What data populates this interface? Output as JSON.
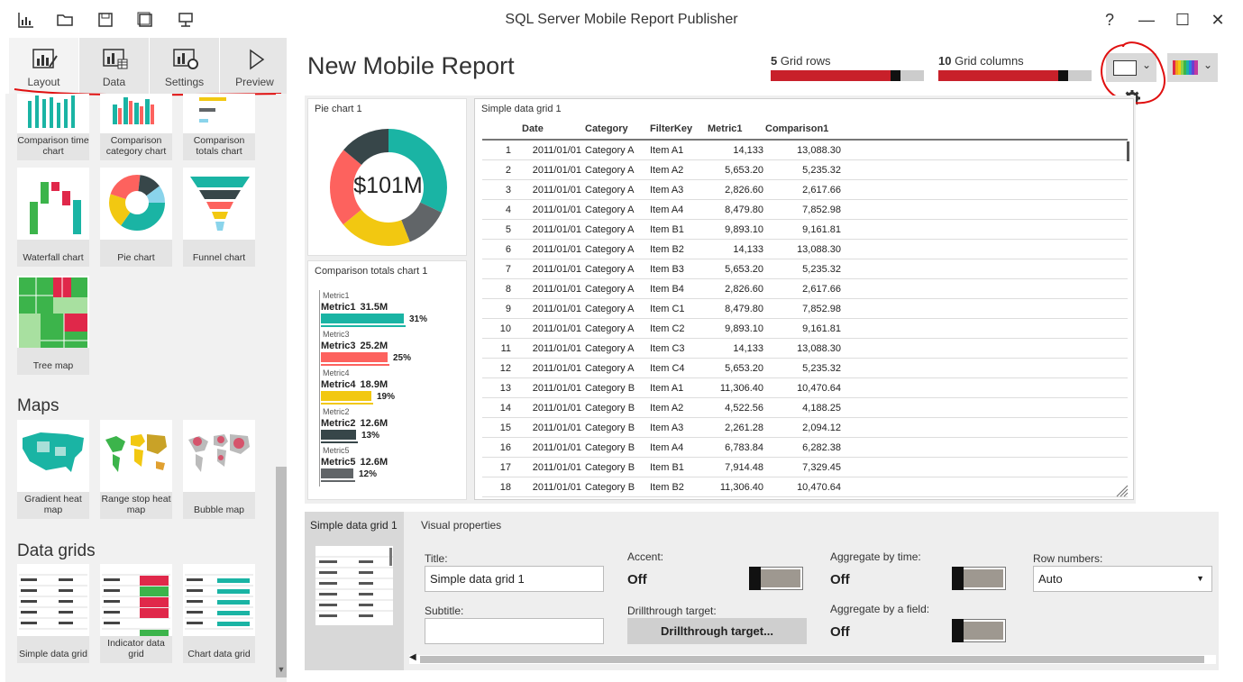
{
  "app": {
    "title": "SQL Server Mobile Report Publisher"
  },
  "window": {
    "help": "?",
    "minimize": "—",
    "maximize": "☐",
    "close": "✕"
  },
  "tabs": [
    {
      "label": "Layout"
    },
    {
      "label": "Data"
    },
    {
      "label": "Settings"
    },
    {
      "label": "Preview"
    }
  ],
  "gallery": {
    "row1": [
      "Comparison time chart",
      "Comparison category chart",
      "Comparison totals chart"
    ],
    "row2": [
      "Waterfall chart",
      "Pie chart",
      "Funnel chart"
    ],
    "row3": [
      "Tree map"
    ],
    "maps_heading": "Maps",
    "maps": [
      "Gradient heat map",
      "Range stop heat map",
      "Bubble map"
    ],
    "grids_heading": "Data grids",
    "grids": [
      "Simple data grid",
      "Indicator data grid",
      "Chart data grid"
    ]
  },
  "report": {
    "title": "New Mobile Report",
    "grid_rows": {
      "value": "5",
      "label": "Grid rows",
      "fill": 0.85
    },
    "grid_columns": {
      "value": "10",
      "label": "Grid columns",
      "fill": 0.85
    }
  },
  "pie": {
    "title": "Pie chart 1",
    "center": "$101M",
    "colors": [
      "#1ab4a4",
      "#616568",
      "#f2c811",
      "#fd625e",
      "#374649"
    ]
  },
  "comparison": {
    "title": "Comparison totals chart 1",
    "items": [
      {
        "small": "Metric1",
        "name": "Metric1",
        "value": "31.5M",
        "pct": "31%",
        "frac": 0.31,
        "color": "#1ab4a4"
      },
      {
        "small": "Metric3",
        "name": "Metric3",
        "value": "25.2M",
        "pct": "25%",
        "frac": 0.25,
        "color": "#fd625e"
      },
      {
        "small": "Metric4",
        "name": "Metric4",
        "value": "18.9M",
        "pct": "19%",
        "frac": 0.19,
        "color": "#f2c811"
      },
      {
        "small": "Metric2",
        "name": "Metric2",
        "value": "12.6M",
        "pct": "13%",
        "frac": 0.13,
        "color": "#374649"
      },
      {
        "small": "Metric5",
        "name": "Metric5",
        "value": "12.6M",
        "pct": "12%",
        "frac": 0.12,
        "color": "#616568"
      }
    ]
  },
  "datagrid": {
    "title": "Simple data grid 1",
    "headers": [
      "Date",
      "Category",
      "FilterKey",
      "Metric1",
      "Comparison1"
    ],
    "rows": [
      [
        "1",
        "2011/01/01",
        "Category A",
        "Item A1",
        "14,133",
        "13,088.30"
      ],
      [
        "2",
        "2011/01/01",
        "Category A",
        "Item A2",
        "5,653.20",
        "5,235.32"
      ],
      [
        "3",
        "2011/01/01",
        "Category A",
        "Item A3",
        "2,826.60",
        "2,617.66"
      ],
      [
        "4",
        "2011/01/01",
        "Category A",
        "Item A4",
        "8,479.80",
        "7,852.98"
      ],
      [
        "5",
        "2011/01/01",
        "Category A",
        "Item B1",
        "9,893.10",
        "9,161.81"
      ],
      [
        "6",
        "2011/01/01",
        "Category A",
        "Item B2",
        "14,133",
        "13,088.30"
      ],
      [
        "7",
        "2011/01/01",
        "Category A",
        "Item B3",
        "5,653.20",
        "5,235.32"
      ],
      [
        "8",
        "2011/01/01",
        "Category A",
        "Item B4",
        "2,826.60",
        "2,617.66"
      ],
      [
        "9",
        "2011/01/01",
        "Category A",
        "Item C1",
        "8,479.80",
        "7,852.98"
      ],
      [
        "10",
        "2011/01/01",
        "Category A",
        "Item C2",
        "9,893.10",
        "9,161.81"
      ],
      [
        "11",
        "2011/01/01",
        "Category A",
        "Item C3",
        "14,133",
        "13,088.30"
      ],
      [
        "12",
        "2011/01/01",
        "Category A",
        "Item C4",
        "5,653.20",
        "5,235.32"
      ],
      [
        "13",
        "2011/01/01",
        "Category B",
        "Item A1",
        "11,306.40",
        "10,470.64"
      ],
      [
        "14",
        "2011/01/01",
        "Category B",
        "Item A2",
        "4,522.56",
        "4,188.25"
      ],
      [
        "15",
        "2011/01/01",
        "Category B",
        "Item A3",
        "2,261.28",
        "2,094.12"
      ],
      [
        "16",
        "2011/01/01",
        "Category B",
        "Item A4",
        "6,783.84",
        "6,282.38"
      ],
      [
        "17",
        "2011/01/01",
        "Category B",
        "Item B1",
        "7,914.48",
        "7,329.45"
      ],
      [
        "18",
        "2011/01/01",
        "Category B",
        "Item B2",
        "11,306.40",
        "10,470.64"
      ]
    ]
  },
  "props": {
    "selected": "Simple data grid 1",
    "heading": "Visual properties",
    "title_label": "Title:",
    "title_value": "Simple data grid 1",
    "subtitle_label": "Subtitle:",
    "subtitle_value": "",
    "accent_label": "Accent:",
    "accent_value": "Off",
    "drill_label": "Drillthrough target:",
    "drill_button": "Drillthrough target...",
    "agg_time_label": "Aggregate by time:",
    "agg_time_value": "Off",
    "agg_field_label": "Aggregate by a field:",
    "agg_field_value": "Off",
    "rownum_label": "Row numbers:",
    "rownum_value": "Auto"
  }
}
